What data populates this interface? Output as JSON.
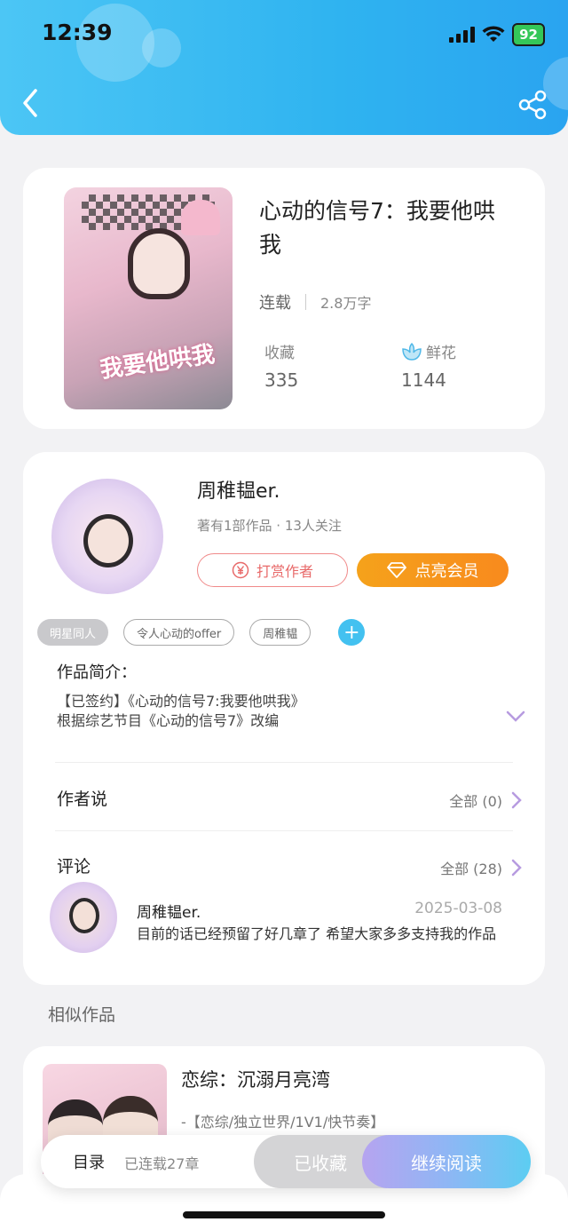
{
  "status_bar": {
    "time": "12:39",
    "battery": "92"
  },
  "colors": {
    "header": "#2fb3f0",
    "accent_orange": "#f88a1d",
    "reward_red": "#e86a6a",
    "tag_add": "#43c1f0"
  },
  "book": {
    "title": "心动的信号7：我要他哄我",
    "status": "连载",
    "word_count": "2.8万字",
    "favorites_label": "收藏",
    "favorites_value": "335",
    "flowers_label": "鲜花",
    "flowers_value": "1144"
  },
  "author": {
    "name": "周稚韫er.",
    "meta": "著有1部作品 · 13人关注",
    "reward_label": "打赏作者",
    "vip_label": "点亮会员"
  },
  "tags": [
    "明星同人",
    "令人心动的offer",
    "周稚韫"
  ],
  "intro": {
    "title": "作品简介：",
    "line1": "【已签约】《心动的信号7:我要他哄我》",
    "line2": "根据综艺节目《心动的信号7》改编"
  },
  "author_says": {
    "title": "作者说",
    "link": "全部 (0)"
  },
  "comments": {
    "title": "评论",
    "link": "全部 (28)",
    "items": [
      {
        "name": "周稚韫er.",
        "date": "2025-03-08",
        "text": "目前的话已经预留了好几章了 希望大家多多支持我的作品"
      }
    ]
  },
  "similar": {
    "title": "相似作品",
    "items": [
      {
        "title": "恋综：沉溺月亮湾",
        "desc": "-【恋综/独立世界/1V1/快节奏】"
      }
    ]
  },
  "bottom_bar": {
    "toc": "目录",
    "chapters": "已连载27章",
    "favorited": "已收藏",
    "continue": "继续阅读"
  }
}
